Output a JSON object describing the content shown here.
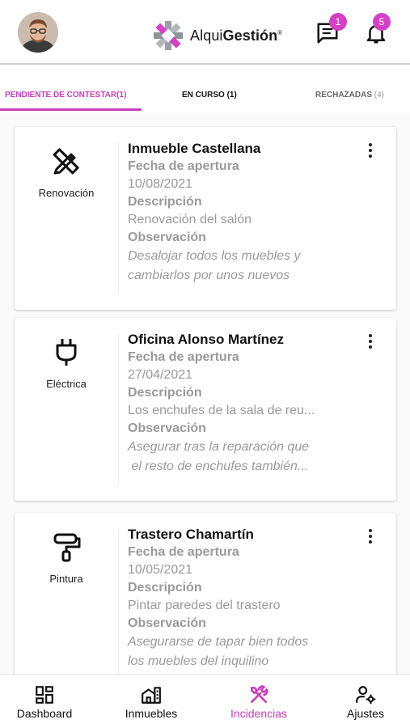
{
  "header": {
    "brand_light": "Alqui",
    "brand_bold": "Gestión",
    "brand_mark": "®",
    "messages_badge": "1",
    "notifications_badge": "5"
  },
  "tabs": [
    {
      "label": "PENDIENTE DE CONTESTAR",
      "count": "(1)",
      "active": true
    },
    {
      "label": "EN CURSO",
      "count": "(1)",
      "active": false
    },
    {
      "label": "RECHAZADAS",
      "count": "(4)",
      "active": false
    }
  ],
  "cards": [
    {
      "category": "Renovación",
      "icon": "pencil-ruler-icon",
      "title": "Inmueble Castellana",
      "fecha_label": "Fecha de apertura",
      "fecha": "10/08/2021",
      "desc_label": "Descripción",
      "descripcion": "Renovación del salón",
      "obs_label": "Observación",
      "obs_line1": "Desalojar todos los muebles y",
      "obs_line2": "cambiarlos por unos nuevos"
    },
    {
      "category": "Eléctrica",
      "icon": "plug-icon",
      "title": "Oficina Alonso Martínez",
      "fecha_label": "Fecha de apertura",
      "fecha": "27/04/2021",
      "desc_label": "Descripción",
      "descripcion": "Los enchufes de la sala de reu...",
      "obs_label": "Observación",
      "obs_line1": "Asegurar tras la reparación que",
      "obs_line2": " el resto de enchufes también..."
    },
    {
      "category": "Pintura",
      "icon": "paint-roller-icon",
      "title": "Trastero Chamartín",
      "fecha_label": "Fecha de apertura",
      "fecha": "10/05/2021",
      "desc_label": "Descripción",
      "descripcion": "Pintar paredes del trastero",
      "obs_label": "Observación",
      "obs_line1": "Asegurarse de tapar bien todos",
      "obs_line2": "los muebles del inquilino"
    }
  ],
  "bottom_nav": [
    {
      "label": "Dashboard",
      "icon": "dashboard-icon",
      "active": false
    },
    {
      "label": "Inmuebles",
      "icon": "building-icon",
      "active": false
    },
    {
      "label": "Incidencias",
      "icon": "tools-icon",
      "active": true
    },
    {
      "label": "Ajustes",
      "icon": "user-settings-icon",
      "active": false
    }
  ],
  "colors": {
    "accent": "#c83dbd",
    "badge": "#d63fc7",
    "muted_text": "#9a9a9a"
  }
}
